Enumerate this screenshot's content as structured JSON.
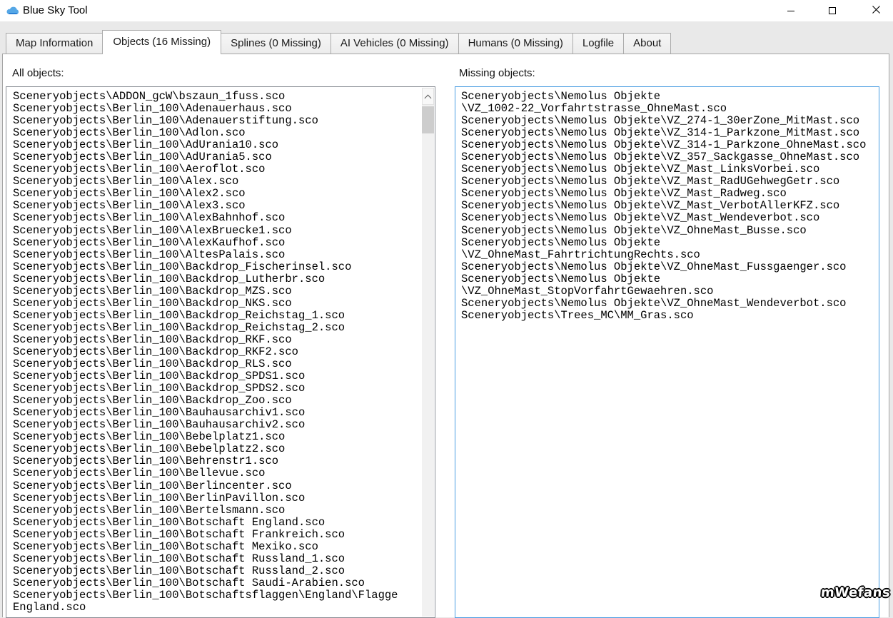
{
  "window": {
    "title": "Blue Sky Tool"
  },
  "icons": {
    "app": "cloud-icon",
    "minimize": "minimize-icon",
    "maximize": "maximize-icon",
    "close": "close-icon",
    "scroll_up": "chevron-up-icon"
  },
  "colors": {
    "titlebar_bg": "#ffffff",
    "client_bg": "#e9e9e9",
    "app_icon_blue": "#3898e3",
    "focused_list_border": "#4a9de2",
    "list_border": "#888c93"
  },
  "tabs": [
    {
      "label": "Map Information"
    },
    {
      "label": "Objects (16 Missing)"
    },
    {
      "label": "Splines (0 Missing)"
    },
    {
      "label": "AI Vehicles (0 Missing)"
    },
    {
      "label": "Humans (0 Missing)"
    },
    {
      "label": "Logfile"
    },
    {
      "label": "About"
    }
  ],
  "all_objects": {
    "label": "All objects:",
    "lines": [
      "Sceneryobjects\\ADDON_gcW\\bszaun_1fuss.sco",
      "Sceneryobjects\\Berlin_100\\Adenauerhaus.sco",
      "Sceneryobjects\\Berlin_100\\Adenauerstiftung.sco",
      "Sceneryobjects\\Berlin_100\\Adlon.sco",
      "Sceneryobjects\\Berlin_100\\AdUrania10.sco",
      "Sceneryobjects\\Berlin_100\\AdUrania5.sco",
      "Sceneryobjects\\Berlin_100\\Aeroflot.sco",
      "Sceneryobjects\\Berlin_100\\Alex.sco",
      "Sceneryobjects\\Berlin_100\\Alex2.sco",
      "Sceneryobjects\\Berlin_100\\Alex3.sco",
      "Sceneryobjects\\Berlin_100\\AlexBahnhof.sco",
      "Sceneryobjects\\Berlin_100\\AlexBruecke1.sco",
      "Sceneryobjects\\Berlin_100\\AlexKaufhof.sco",
      "Sceneryobjects\\Berlin_100\\AltesPalais.sco",
      "Sceneryobjects\\Berlin_100\\Backdrop_Fischerinsel.sco",
      "Sceneryobjects\\Berlin_100\\Backdrop_Lutherbr.sco",
      "Sceneryobjects\\Berlin_100\\Backdrop_MZS.sco",
      "Sceneryobjects\\Berlin_100\\Backdrop_NKS.sco",
      "Sceneryobjects\\Berlin_100\\Backdrop_Reichstag_1.sco",
      "Sceneryobjects\\Berlin_100\\Backdrop_Reichstag_2.sco",
      "Sceneryobjects\\Berlin_100\\Backdrop_RKF.sco",
      "Sceneryobjects\\Berlin_100\\Backdrop_RKF2.sco",
      "Sceneryobjects\\Berlin_100\\Backdrop_RLS.sco",
      "Sceneryobjects\\Berlin_100\\Backdrop_SPDS1.sco",
      "Sceneryobjects\\Berlin_100\\Backdrop_SPDS2.sco",
      "Sceneryobjects\\Berlin_100\\Backdrop_Zoo.sco",
      "Sceneryobjects\\Berlin_100\\Bauhausarchiv1.sco",
      "Sceneryobjects\\Berlin_100\\Bauhausarchiv2.sco",
      "Sceneryobjects\\Berlin_100\\Bebelplatz1.sco",
      "Sceneryobjects\\Berlin_100\\Bebelplatz2.sco",
      "Sceneryobjects\\Berlin_100\\Behrenstr1.sco",
      "Sceneryobjects\\Berlin_100\\Bellevue.sco",
      "Sceneryobjects\\Berlin_100\\Berlincenter.sco",
      "Sceneryobjects\\Berlin_100\\BerlinPavillon.sco",
      "Sceneryobjects\\Berlin_100\\Bertelsmann.sco",
      "Sceneryobjects\\Berlin_100\\Botschaft England.sco",
      "Sceneryobjects\\Berlin_100\\Botschaft Frankreich.sco",
      "Sceneryobjects\\Berlin_100\\Botschaft Mexiko.sco",
      "Sceneryobjects\\Berlin_100\\Botschaft Russland_1.sco",
      "Sceneryobjects\\Berlin_100\\Botschaft Russland_2.sco",
      "Sceneryobjects\\Berlin_100\\Botschaft Saudi-Arabien.sco",
      "Sceneryobjects\\Berlin_100\\Botschaftsflaggen\\England\\Flagge",
      "England.sco"
    ]
  },
  "missing_objects": {
    "label": "Missing objects:",
    "lines": [
      "Sceneryobjects\\Nemolus Objekte",
      "\\VZ_1002-22_Vorfahrtstrasse_OhneMast.sco",
      "Sceneryobjects\\Nemolus Objekte\\VZ_274-1_30erZone_MitMast.sco",
      "Sceneryobjects\\Nemolus Objekte\\VZ_314-1_Parkzone_MitMast.sco",
      "Sceneryobjects\\Nemolus Objekte\\VZ_314-1_Parkzone_OhneMast.sco",
      "Sceneryobjects\\Nemolus Objekte\\VZ_357_Sackgasse_OhneMast.sco",
      "Sceneryobjects\\Nemolus Objekte\\VZ_Mast_LinksVorbei.sco",
      "Sceneryobjects\\Nemolus Objekte\\VZ_Mast_RadUGehwegGetr.sco",
      "Sceneryobjects\\Nemolus Objekte\\VZ_Mast_Radweg.sco",
      "Sceneryobjects\\Nemolus Objekte\\VZ_Mast_VerbotAllerKFZ.sco",
      "Sceneryobjects\\Nemolus Objekte\\VZ_Mast_Wendeverbot.sco",
      "Sceneryobjects\\Nemolus Objekte\\VZ_OhneMast_Busse.sco",
      "Sceneryobjects\\Nemolus Objekte",
      "\\VZ_OhneMast_FahrtrichtungRechts.sco",
      "Sceneryobjects\\Nemolus Objekte\\VZ_OhneMast_Fussgaenger.sco",
      "Sceneryobjects\\Nemolus Objekte",
      "\\VZ_OhneMast_StopVorfahrtGewaehren.sco",
      "Sceneryobjects\\Nemolus Objekte\\VZ_OhneMast_Wendeverbot.sco",
      "Sceneryobjects\\Trees_MC\\MM_Gras.sco"
    ]
  },
  "watermark": "mWefans"
}
